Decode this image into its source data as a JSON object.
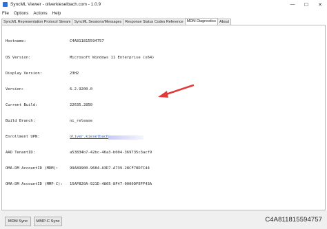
{
  "window": {
    "title": "SyncML Viewer - oliverkieselbach.com - 1.0.9",
    "app_icon": "syncml-app-icon",
    "controls": [
      "—",
      "☐",
      "✕"
    ]
  },
  "menu": [
    "File",
    "Options",
    "Actions",
    "Help"
  ],
  "tabs": [
    {
      "label": "SyncML Representation Protocol Stream",
      "active": false
    },
    {
      "label": "SyncML Sessions/Messages",
      "active": false
    },
    {
      "label": "Response Status Codes Reference",
      "active": false
    },
    {
      "label": "MDM Diagnostics",
      "active": true
    },
    {
      "label": "About",
      "active": false
    }
  ],
  "diagnostics": {
    "rows": [
      {
        "label": "Hostname:",
        "value": "C4A811815594757"
      },
      {
        "label": "OS Version:",
        "value": "Microsoft Windows 11 Enterprise (x64)"
      },
      {
        "label": "Display Version:",
        "value": "23H2"
      },
      {
        "label": "Version:",
        "value": "6.2.9200.0"
      },
      {
        "label": "Current Build:",
        "value": "22635.2850"
      },
      {
        "label": "Build Branch:",
        "value": "ni_release"
      },
      {
        "label": "Enrollment UPN:",
        "value": "oliver.kieselbach"
      },
      {
        "label": "AAD TenantID:",
        "value": "a53834b7-42bc-46a3-b004-369735c3acf9"
      },
      {
        "label": "OMA-DM AccountID (MDM):",
        "value": "99A89900-9684-A3D7-A739-28CF78D7C44"
      },
      {
        "label": "OMA-DM AccountID (MMP-C):",
        "value": "15AFB20A-921D-4865-8F47-0000DFEFF43A"
      }
    ]
  },
  "annotation": {
    "arrow_color": "#e03a3a"
  },
  "bottom": {
    "mdm_sync_label": "MDM Sync",
    "mmpc_sync_label": "MMP-C Sync",
    "device_id": "C4A811815594757"
  },
  "colors": {
    "link": "#1e55c8",
    "accent": "#2f6fd8"
  }
}
